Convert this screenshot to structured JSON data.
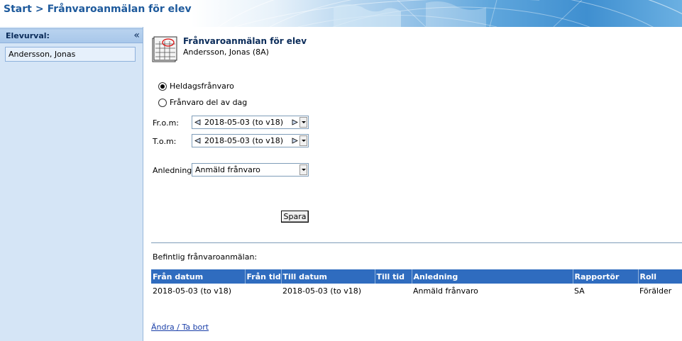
{
  "breadcrumb": {
    "home": "Start",
    "separator": ">",
    "current": "Frånvaroanmälan för elev"
  },
  "sidebar": {
    "title": "Elevurval:",
    "collapse_icon": "double-chevron-left-icon",
    "student": "Andersson, Jonas"
  },
  "form": {
    "title": "Frånvaroanmälan för elev",
    "subtitle": "Andersson, Jonas  (8A)",
    "radio_fullday": "Heldagsfrånvaro",
    "radio_partday": "Frånvaro del av dag",
    "selected_radio": "fullday",
    "from_label": "Fr.o.m:",
    "from_value": "2018-05-03 (to v18)",
    "to_label": "T.o.m:",
    "to_value": "2018-05-03 (to v18)",
    "reason_label": "Anledning:",
    "reason_value": "Anmäld frånvaro",
    "save_label": "Spara"
  },
  "existing": {
    "label": "Befintlig frånvaroanmälan:",
    "headers": [
      "Från datum",
      "Från tid",
      "Till datum",
      "Till tid",
      "Anledning",
      "Rapportör",
      "Roll"
    ],
    "rows": [
      [
        "2018-05-03 (to v18)",
        "",
        "2018-05-03 (to v18)",
        "",
        "Anmäld frånvaro",
        "SA",
        "Förälder"
      ]
    ]
  },
  "edit_link": "Ändra / Ta bort",
  "colors": {
    "header_blue": "#2f6cbf",
    "sidebar_bg": "#d5e5f6",
    "title_text": "#1e5a9c"
  }
}
